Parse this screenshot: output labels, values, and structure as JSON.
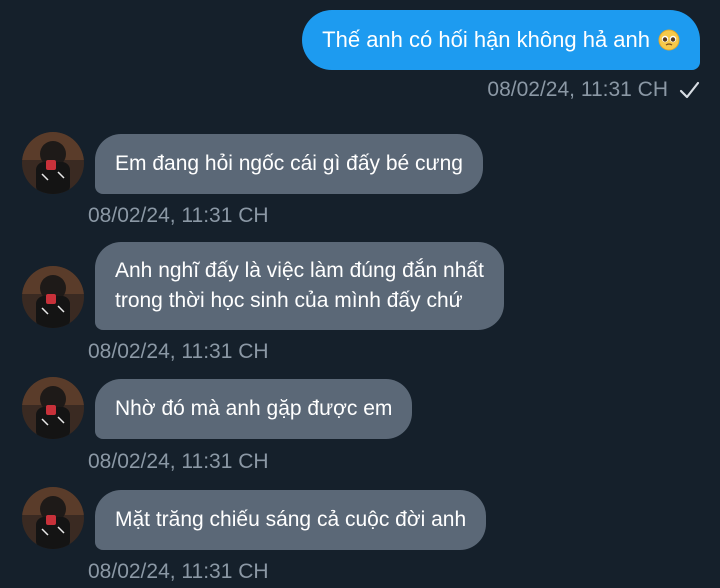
{
  "colors": {
    "background": "#15202b",
    "sent_bubble": "#1d9bf0",
    "received_bubble": "#5b6877",
    "meta_text": "#8b98a5"
  },
  "sent": {
    "text": "Thế anh có hối hận không hả anh",
    "emoji": "pleading-face-emoji",
    "timestamp": "08/02/24, 11:31 CH",
    "status_icon": "check-icon"
  },
  "received": [
    {
      "lines": [
        "Em đang hỏi ngốc cái gì đấy bé cưng"
      ],
      "timestamp": "08/02/24, 11:31 CH"
    },
    {
      "lines": [
        "Anh nghĩ đấy là việc làm đúng đắn nhất",
        "trong thời học sinh của mình đấy chứ"
      ],
      "timestamp": "08/02/24, 11:31 CH"
    },
    {
      "lines": [
        "Nhờ đó mà anh gặp được em"
      ],
      "timestamp": "08/02/24, 11:31 CH"
    },
    {
      "lines": [
        "Mặt trăng chiếu sáng cả cuộc đời anh"
      ],
      "timestamp": "08/02/24, 11:31 CH"
    }
  ]
}
